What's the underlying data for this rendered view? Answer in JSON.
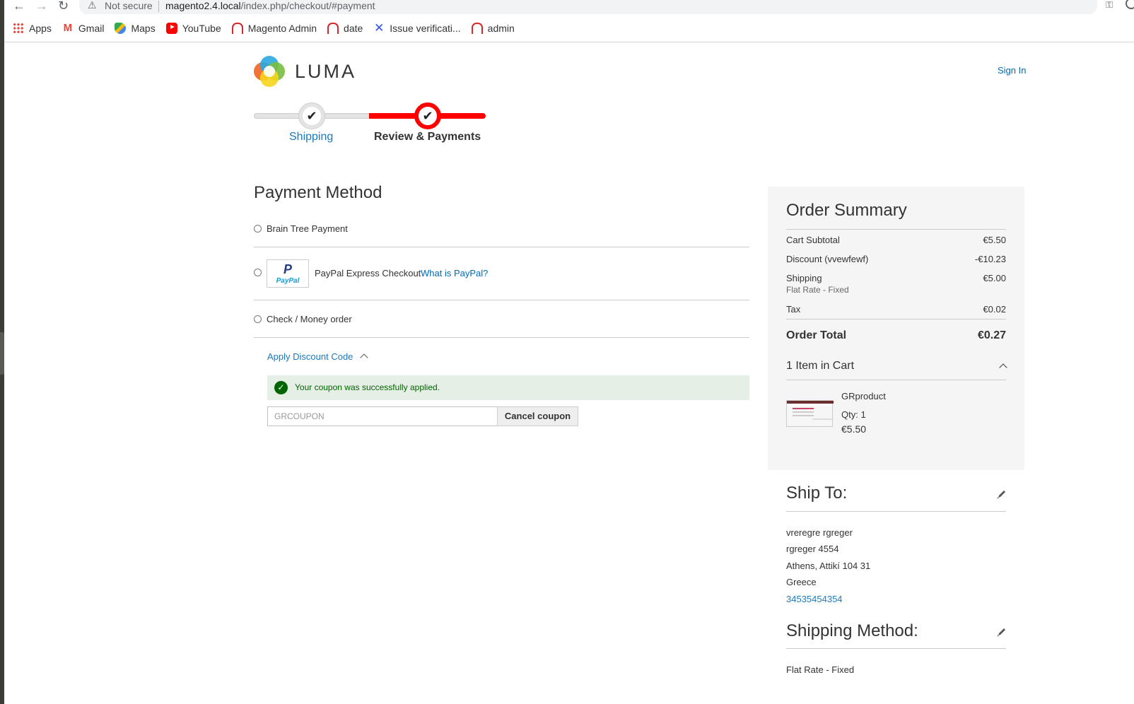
{
  "browser": {
    "not_secure": "Not secure",
    "url_host": "magento2.4.local",
    "url_path": "/index.php/checkout/#payment",
    "bookmarks": [
      {
        "label": "Apps",
        "icon": "apps-icon"
      },
      {
        "label": "Gmail",
        "icon": "gmail-icon"
      },
      {
        "label": "Maps",
        "icon": "maps-icon"
      },
      {
        "label": "YouTube",
        "icon": "youtube-icon"
      },
      {
        "label": "Magento Admin",
        "icon": "magento-icon"
      },
      {
        "label": "date",
        "icon": "magento-icon"
      },
      {
        "label": "Issue verificati...",
        "icon": "jira-icon"
      },
      {
        "label": "admin",
        "icon": "magento-icon"
      }
    ]
  },
  "header": {
    "logo_text": "LUMA",
    "sign_in": "Sign In"
  },
  "progress": {
    "steps": [
      {
        "label": "Shipping",
        "state": "complete"
      },
      {
        "label": "Review & Payments",
        "state": "active"
      }
    ]
  },
  "payment": {
    "title": "Payment Method",
    "methods": [
      {
        "label": "Brain Tree Payment"
      },
      {
        "label": "PayPal Express Checkout",
        "logo_letter": "P",
        "logo_text": "PayPal",
        "what_link": "What is PayPal?"
      },
      {
        "label": "Check / Money order"
      }
    ],
    "discount": {
      "toggle_label": "Apply Discount Code",
      "success_message": "Your coupon was successfully applied.",
      "coupon_value": "GRCOUPON",
      "cancel_label": "Cancel coupon"
    }
  },
  "summary": {
    "title": "Order Summary",
    "rows": [
      {
        "label": "Cart Subtotal",
        "value": "€5.50"
      },
      {
        "label": "Discount (vvewfewf)",
        "value": "-€10.23"
      },
      {
        "label": "Shipping",
        "value": "€5.00",
        "sub": "Flat Rate - Fixed"
      },
      {
        "label": "Tax",
        "value": "€0.02"
      }
    ],
    "total": {
      "label": "Order Total",
      "value": "€0.27"
    },
    "items_header": "1 Item in Cart",
    "item": {
      "name": "GRproduct",
      "qty": "Qty: 1",
      "price": "€5.50"
    }
  },
  "ship_to": {
    "title": "Ship To:",
    "lines": [
      "vreregre rgreger",
      "rgreger 4554",
      "Athens, Attikí 104 31",
      "Greece"
    ],
    "phone": "34535454354"
  },
  "shipping_method": {
    "title": "Shipping Method:",
    "value": "Flat Rate - Fixed"
  },
  "colors": {
    "accent_link": "#1979c3",
    "progress_active": "#ff0000",
    "success_bg": "#e5efe5",
    "success_text": "#006400"
  }
}
